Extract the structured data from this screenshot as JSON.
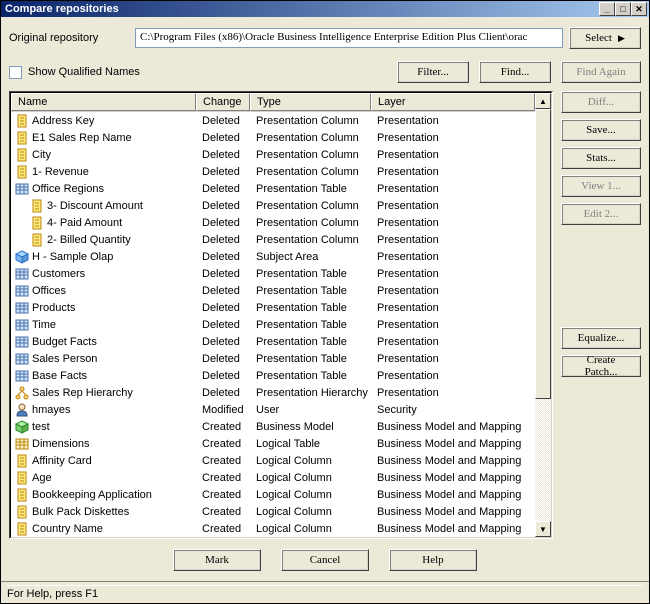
{
  "window": {
    "title": "Compare repositories"
  },
  "labels": {
    "original_repository": "Original repository",
    "show_qualified_names": "Show Qualified Names"
  },
  "path": "C:\\Program Files (x86)\\Oracle Business Intelligence Enterprise Edition Plus Client\\orac",
  "buttons": {
    "select": "Select",
    "filter": "Filter...",
    "find": "Find...",
    "find_again": "Find Again",
    "diff": "Diff...",
    "save": "Save...",
    "stats": "Stats...",
    "view1": "View 1...",
    "edit2": "Edit 2...",
    "equalize": "Equalize...",
    "create_patch": "Create Patch...",
    "mark": "Mark",
    "cancel": "Cancel",
    "help": "Help"
  },
  "columns": {
    "name": "Name",
    "change": "Change",
    "type": "Type",
    "layer": "Layer"
  },
  "rows": [
    {
      "icon": "col-yellow",
      "indent": 0,
      "name": "Address Key",
      "change": "Deleted",
      "type": "Presentation Column",
      "layer": "Presentation"
    },
    {
      "icon": "col-yellow",
      "indent": 0,
      "name": "E1  Sales Rep Name",
      "change": "Deleted",
      "type": "Presentation Column",
      "layer": "Presentation"
    },
    {
      "icon": "col-yellow",
      "indent": 0,
      "name": "City",
      "change": "Deleted",
      "type": "Presentation Column",
      "layer": "Presentation"
    },
    {
      "icon": "col-yellow",
      "indent": 0,
      "name": "1- Revenue",
      "change": "Deleted",
      "type": "Presentation Column",
      "layer": "Presentation"
    },
    {
      "icon": "table-blue",
      "indent": 0,
      "name": "Office Regions",
      "change": "Deleted",
      "type": "Presentation Table",
      "layer": "Presentation"
    },
    {
      "icon": "col-yellow",
      "indent": 1,
      "name": "3- Discount Amount",
      "change": "Deleted",
      "type": "Presentation Column",
      "layer": "Presentation"
    },
    {
      "icon": "col-yellow",
      "indent": 1,
      "name": "4- Paid Amount",
      "change": "Deleted",
      "type": "Presentation Column",
      "layer": "Presentation"
    },
    {
      "icon": "col-yellow",
      "indent": 1,
      "name": "2- Billed Quantity",
      "change": "Deleted",
      "type": "Presentation Column",
      "layer": "Presentation"
    },
    {
      "icon": "cube-blue",
      "indent": 0,
      "name": "H - Sample Olap",
      "change": "Deleted",
      "type": "Subject Area",
      "layer": "Presentation"
    },
    {
      "icon": "table-blue",
      "indent": 0,
      "name": "Customers",
      "change": "Deleted",
      "type": "Presentation Table",
      "layer": "Presentation"
    },
    {
      "icon": "table-blue",
      "indent": 0,
      "name": "Offices",
      "change": "Deleted",
      "type": "Presentation Table",
      "layer": "Presentation"
    },
    {
      "icon": "table-blue",
      "indent": 0,
      "name": "Products",
      "change": "Deleted",
      "type": "Presentation Table",
      "layer": "Presentation"
    },
    {
      "icon": "table-blue",
      "indent": 0,
      "name": "Time",
      "change": "Deleted",
      "type": "Presentation Table",
      "layer": "Presentation"
    },
    {
      "icon": "table-blue",
      "indent": 0,
      "name": "Budget Facts",
      "change": "Deleted",
      "type": "Presentation Table",
      "layer": "Presentation"
    },
    {
      "icon": "table-blue",
      "indent": 0,
      "name": "Sales Person",
      "change": "Deleted",
      "type": "Presentation Table",
      "layer": "Presentation"
    },
    {
      "icon": "table-blue",
      "indent": 0,
      "name": "Base Facts",
      "change": "Deleted",
      "type": "Presentation Table",
      "layer": "Presentation"
    },
    {
      "icon": "hierarchy",
      "indent": 0,
      "name": "Sales Rep Hierarchy",
      "change": "Deleted",
      "type": "Presentation Hierarchy",
      "layer": "Presentation"
    },
    {
      "icon": "user",
      "indent": 0,
      "name": "hmayes",
      "change": "Modified",
      "type": "User",
      "layer": "Security"
    },
    {
      "icon": "model-green",
      "indent": 0,
      "name": "test",
      "change": "Created",
      "type": "Business Model",
      "layer": "Business Model and Mapping"
    },
    {
      "icon": "table-yellow",
      "indent": 0,
      "name": "Dimensions",
      "change": "Created",
      "type": "Logical Table",
      "layer": "Business Model and Mapping"
    },
    {
      "icon": "col-yellow",
      "indent": 0,
      "name": "Affinity Card",
      "change": "Created",
      "type": "Logical Column",
      "layer": "Business Model and Mapping"
    },
    {
      "icon": "col-yellow",
      "indent": 0,
      "name": "Age",
      "change": "Created",
      "type": "Logical Column",
      "layer": "Business Model and Mapping"
    },
    {
      "icon": "col-yellow",
      "indent": 0,
      "name": "Bookkeeping Application",
      "change": "Created",
      "type": "Logical Column",
      "layer": "Business Model and Mapping"
    },
    {
      "icon": "col-yellow",
      "indent": 0,
      "name": "Bulk Pack Diskettes",
      "change": "Created",
      "type": "Logical Column",
      "layer": "Business Model and Mapping"
    },
    {
      "icon": "col-yellow",
      "indent": 0,
      "name": "Country Name",
      "change": "Created",
      "type": "Logical Column",
      "layer": "Business Model and Mapping"
    }
  ],
  "status": "For Help, press F1"
}
